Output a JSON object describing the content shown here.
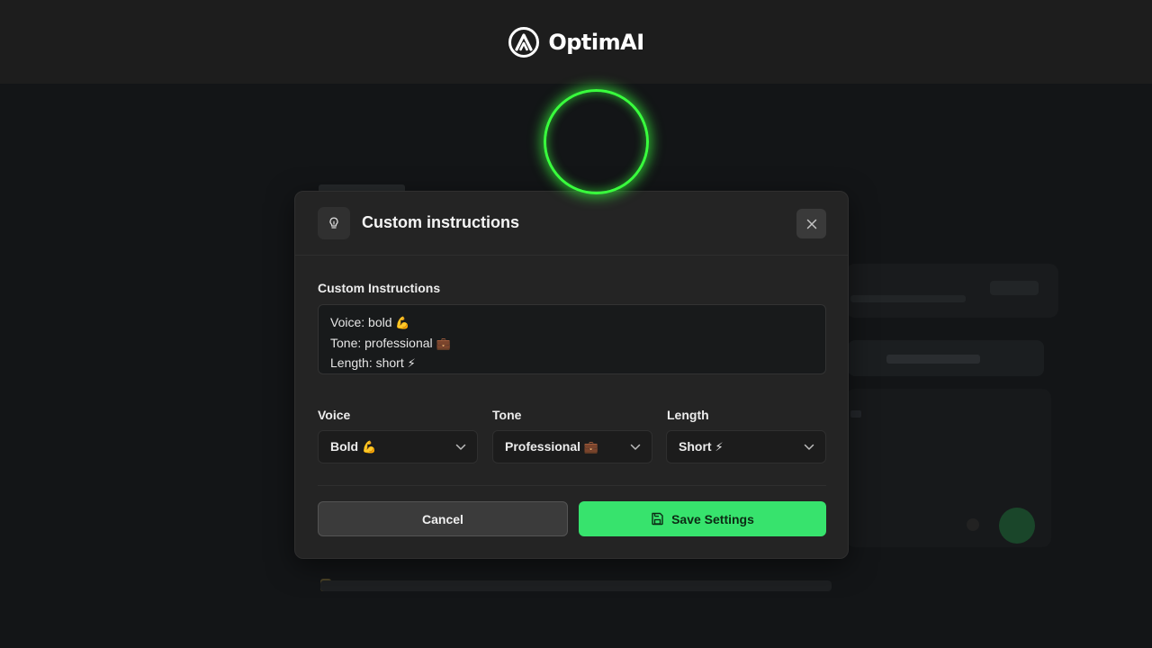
{
  "brand": {
    "name": "OptimAI",
    "logo_icon": "optimai-logo-icon"
  },
  "colors": {
    "background": "#131517",
    "topbar": "#1d1d1d",
    "modal": "#242424",
    "accent_green": "#37e36d",
    "recording_ring": "#39ff3d"
  },
  "modal": {
    "icon": "lightbulb-icon",
    "title": "Custom instructions",
    "close_icon": "close-icon",
    "instructions_label": "Custom Instructions",
    "instructions_lines": [
      {
        "text": "Voice: bold",
        "emoji": "💪"
      },
      {
        "text": "Tone: professional",
        "emoji": "💼"
      },
      {
        "text": "Length: short",
        "emoji": "⚡"
      }
    ],
    "selects": [
      {
        "label": "Voice",
        "value": "Bold",
        "emoji": "💪"
      },
      {
        "label": "Tone",
        "value": "Professional",
        "emoji": "💼"
      },
      {
        "label": "Length",
        "value": "Short",
        "emoji": "⚡"
      }
    ],
    "cancel_label": "Cancel",
    "save_label": "Save Settings",
    "save_icon": "floppy-disk-icon"
  }
}
